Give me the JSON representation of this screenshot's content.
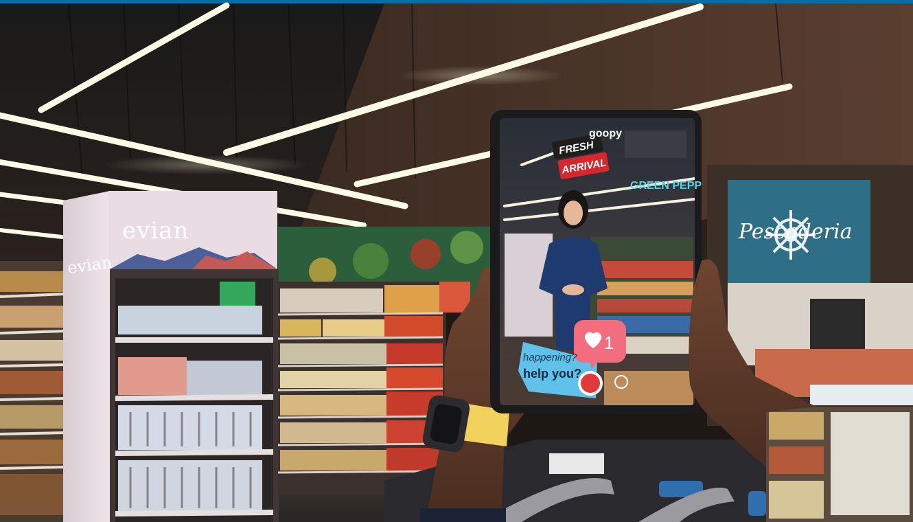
{
  "display": {
    "brand": "evian",
    "tablet_app_logo": "goopy",
    "badge_line1": "FRESH",
    "badge_line2": "ARRIVAL",
    "overlay_sign": "GREEN PEPP",
    "like_count": "1",
    "chat_bubble_line1": "happening?",
    "chat_bubble_line2": "help you?",
    "store_sign": "Pescaderia"
  },
  "colors": {
    "top_bar": "#0a6ea6",
    "evian_panel": "#e9dde3",
    "pescaderia_sign": "#2e6f86",
    "like_bubble": "#f26d7d",
    "chat_bubble": "#5fc0ea",
    "record_dot": "#e23a3a",
    "watch_band": "#f0d25c"
  },
  "icons": {
    "like": "heart-icon",
    "record": "record-button-icon",
    "store_logo": "ship-wheel-icon"
  }
}
